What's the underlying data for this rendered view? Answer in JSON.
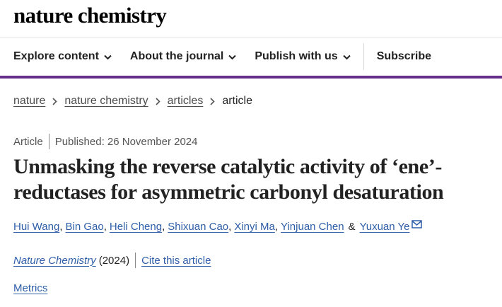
{
  "site": {
    "logo": "nature chemistry"
  },
  "nav": {
    "items": [
      {
        "label": "Explore content"
      },
      {
        "label": "About the journal"
      },
      {
        "label": "Publish with us"
      }
    ],
    "subscribe": "Subscribe"
  },
  "breadcrumb": [
    "nature",
    "nature chemistry",
    "articles",
    "article"
  ],
  "article": {
    "type": "Article",
    "published": "Published: 26 November 2024",
    "title": "Unmasking the reverse catalytic activity of ‘ene’-reductases for asymmetric carbonyl desaturation",
    "authors": [
      "Hui Wang",
      "Bin Gao",
      "Heli Cheng",
      "Shixuan Cao",
      "Xinyi Ma",
      "Yinjuan Chen",
      "Yuxuan Ye"
    ],
    "author_joiners": [
      ",",
      ",",
      ",",
      ",",
      ",",
      "&"
    ],
    "journal": "Nature Chemistry",
    "year": "(2024)",
    "cite_label": "Cite this article",
    "metrics_label": "Metrics"
  },
  "colors": {
    "accent": "#652f8a",
    "link": "#2e5fa8"
  }
}
